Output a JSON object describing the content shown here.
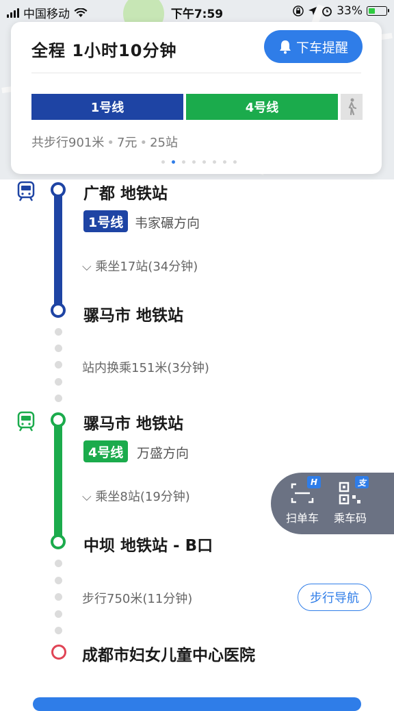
{
  "status_bar": {
    "carrier": "中国移动",
    "time": "下午7:59",
    "battery_percent": "33%",
    "battery_level": 0.33
  },
  "summary": {
    "title": "全程  1小时10分钟",
    "alert_button": "下车提醒",
    "segments": [
      {
        "label": "1号线",
        "color": "#1e44a4"
      },
      {
        "label": "4号线",
        "color": "#1bab4c"
      },
      {
        "label": "",
        "icon": "walk-icon"
      }
    ],
    "walk_total": "共步行901米",
    "fare": "7元",
    "stops": "25站",
    "page_dots": 8,
    "active_dot": 1
  },
  "steps": {
    "station1": "广都 地铁站",
    "line1_tag": "1号线",
    "line1_dir": "韦家碾方向",
    "line1_ride": "乘坐17站(34分钟)",
    "station2": "骡马市 地铁站",
    "transfer": "站内换乘151米(3分钟)",
    "station3": "骡马市 地铁站",
    "line4_tag": "4号线",
    "line4_dir": "万盛方向",
    "line4_ride": "乘坐8站(19分钟)",
    "station4": "中坝 地铁站 - B口",
    "walk": "步行750米(11分钟)",
    "walk_nav_button": "步行导航",
    "destination": "成都市妇女儿童中心医院"
  },
  "float_panel": {
    "scan_bike": "扫单车",
    "scan_bike_badge": "H",
    "ride_code": "乘车码",
    "ride_code_badge": "支"
  },
  "colors": {
    "accent": "#2f7de8",
    "line1": "#1e44a4",
    "line4": "#1bab4c",
    "destination": "#e04455"
  }
}
